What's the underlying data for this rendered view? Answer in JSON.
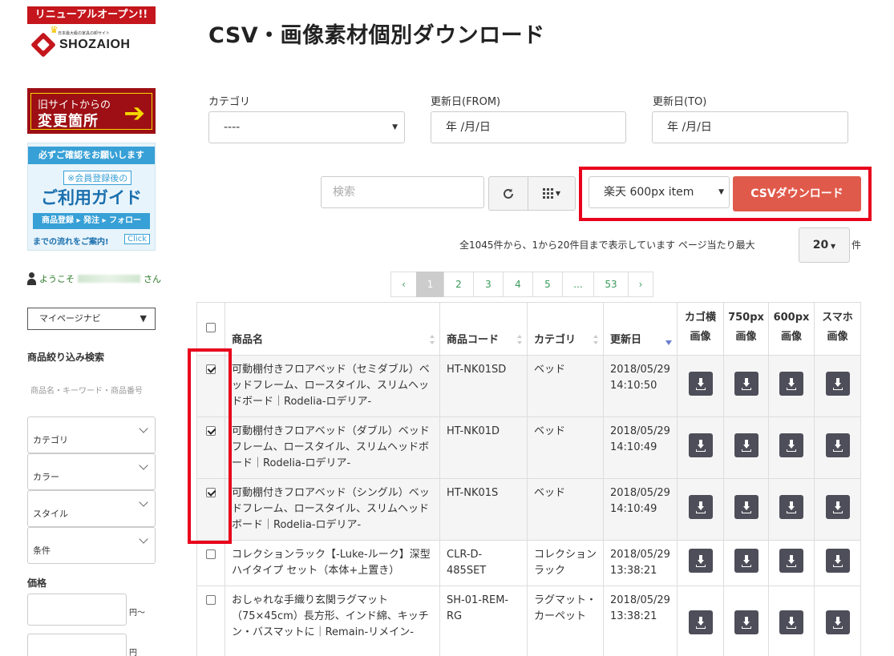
{
  "sidebar": {
    "banner_renewal": {
      "headline": "リニューアルオープン!!",
      "tagline": "日本最大級の家具の卸サイト",
      "logo_text": "SHOZAIOH",
      "line1": "旧サイトからの",
      "line2": "変更箇所"
    },
    "banner_guide": {
      "line1": "必ずご確認をお願いします",
      "line2": "※会員登録後の",
      "line3": "ご利用ガイド",
      "line4": "商品登録 ▸ 発注 ▸ フォロー",
      "line5": "までの流れをご案内!",
      "click": "Click"
    },
    "welcome_prefix": "ようこそ",
    "welcome_suffix": "さん",
    "mypage_nav": "マイページナビ",
    "filter_title": "商品絞り込み検索",
    "filter_placeholder": "商品名・キーワード・商品番号",
    "facets": [
      "カテゴリ",
      "カラー",
      "スタイル",
      "条件"
    ],
    "price_title": "価格",
    "price_unit_from": "円〜",
    "price_unit_to": "円"
  },
  "main": {
    "title": "CSV・画像素材個別ダウンロード",
    "filters": {
      "category_label": "カテゴリ",
      "category_value": "----",
      "from_label": "更新日(FROM)",
      "from_value": "年 /月/日",
      "to_label": "更新日(TO)",
      "to_value": "年 /月/日"
    },
    "toolbar": {
      "search_placeholder": "検索",
      "format_value": "楽天 600px item",
      "csv_button": "CSVダウンロード"
    },
    "summary": "全1045件から、1から20件目まで表示しています ページ当たり最大",
    "per_page": "20",
    "per_page_unit": "件",
    "pagination": [
      "‹",
      "1",
      "2",
      "3",
      "4",
      "5",
      "...",
      "53",
      "›"
    ],
    "table": {
      "headers": {
        "name": "商品名",
        "code": "商品コード",
        "category": "カテゴリ",
        "updated": "更新日",
        "img_kago_1": "カゴ横",
        "img_kago_2": "画像",
        "img_750_1": "750px",
        "img_750_2": "画像",
        "img_600_1": "600px",
        "img_600_2": "画像",
        "img_sp_1": "スマホ",
        "img_sp_2": "画像"
      },
      "rows": [
        {
          "name": "可動棚付きフロアベッド（セミダブル）ベッドフレーム、ロースタイル、スリムヘッドボード｜Rodelia-ロデリア-",
          "code": "HT-NK01SD",
          "category": "ベッド",
          "date": "2018/05/29",
          "time": "14:10:50",
          "checked": true
        },
        {
          "name": "可動棚付きフロアベッド（ダブル）ベッドフレーム、ロースタイル、スリムヘッドボード｜Rodelia-ロデリア-",
          "code": "HT-NK01D",
          "category": "ベッド",
          "date": "2018/05/29",
          "time": "14:10:49",
          "checked": true
        },
        {
          "name": "可動棚付きフロアベッド（シングル）ベッドフレーム、ロースタイル、スリムヘッドボード｜Rodelia-ロデリア-",
          "code": "HT-NK01S",
          "category": "ベッド",
          "date": "2018/05/29",
          "time": "14:10:49",
          "checked": true
        },
        {
          "name": "コレクションラック【-Luke-ルーク】深型ハイタイプ セット（本体+上置き）",
          "code": "CLR-D-485SET",
          "category": "コレクションラック",
          "date": "2018/05/29",
          "time": "13:38:21",
          "checked": false
        },
        {
          "name": "おしゃれな手織り玄関ラグマット（75×45cm）長方形、インド綿、キッチン・バスマットに｜Remain-リメイン-",
          "code": "SH-01-REM-RG",
          "category": "ラグマット・カーペット",
          "date": "2018/05/29",
          "time": "13:38:21",
          "checked": false
        }
      ]
    }
  },
  "colors": {
    "csv_button": "#e05a4b",
    "highlight_box": "#e8001c",
    "pager_link": "#3a9b5a",
    "download_button": "#4e4e5a"
  }
}
